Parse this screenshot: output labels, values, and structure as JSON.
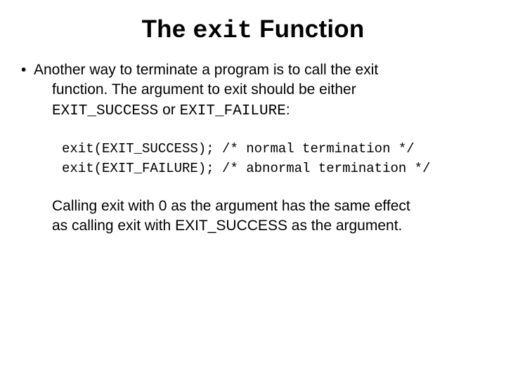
{
  "title": {
    "pre": "The ",
    "code": "exit",
    "post": " Function"
  },
  "bullet": {
    "mark": "•",
    "line1": "Another way to terminate a program is to call the exit",
    "line2_plain_a": "function. The argument to exit should be either",
    "line3_code_a": "EXIT_SUCCESS",
    "line3_plain_mid": " or ",
    "line3_code_b": "EXIT_FAILURE",
    "line3_plain_end": ":"
  },
  "code": {
    "l1": "exit(EXIT_SUCCESS); /* normal termination */",
    "l2": "exit(EXIT_FAILURE); /* abnormal termination */"
  },
  "para": {
    "l1": "Calling exit with 0 as the argument has the same effect",
    "l2": "as calling exit with EXIT_SUCCESS as the argument."
  }
}
